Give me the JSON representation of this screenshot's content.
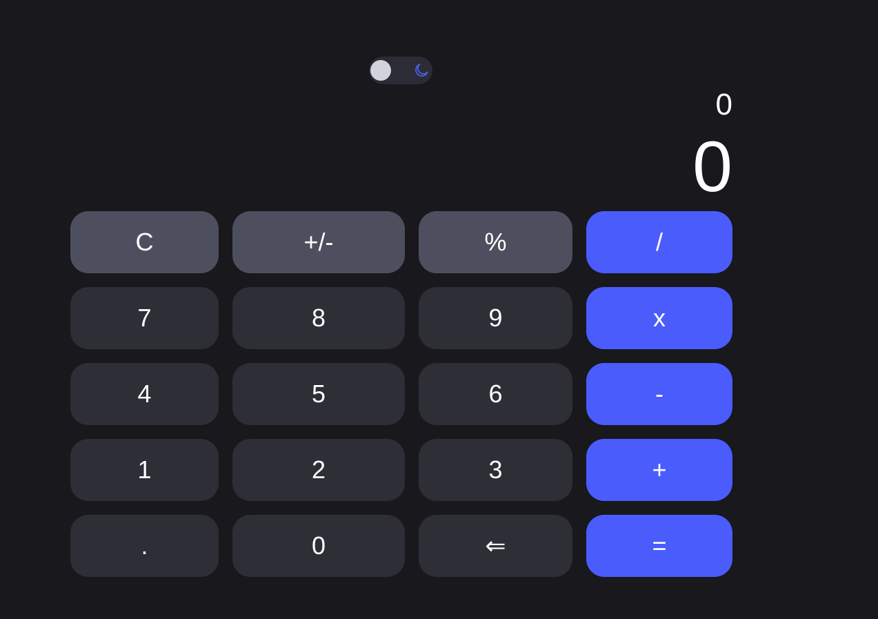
{
  "theme_toggle": {
    "state": "dark",
    "icon": "moon-icon",
    "icon_color": "#4d5be0"
  },
  "display": {
    "previous": "0",
    "current": "0"
  },
  "colors": {
    "background": "#18181d",
    "number_key": "#2e2e37",
    "function_key": "#4e4f5e",
    "operator_key": "#4a5cfc"
  },
  "keys": {
    "clear": "C",
    "negate": "+/-",
    "percent": "%",
    "divide": "/",
    "seven": "7",
    "eight": "8",
    "nine": "9",
    "multiply": "x",
    "four": "4",
    "five": "5",
    "six": "6",
    "subtract": "-",
    "one": "1",
    "two": "2",
    "three": "3",
    "add": "+",
    "decimal": ".",
    "zero": "0",
    "backspace": "⇐",
    "equals": "="
  }
}
